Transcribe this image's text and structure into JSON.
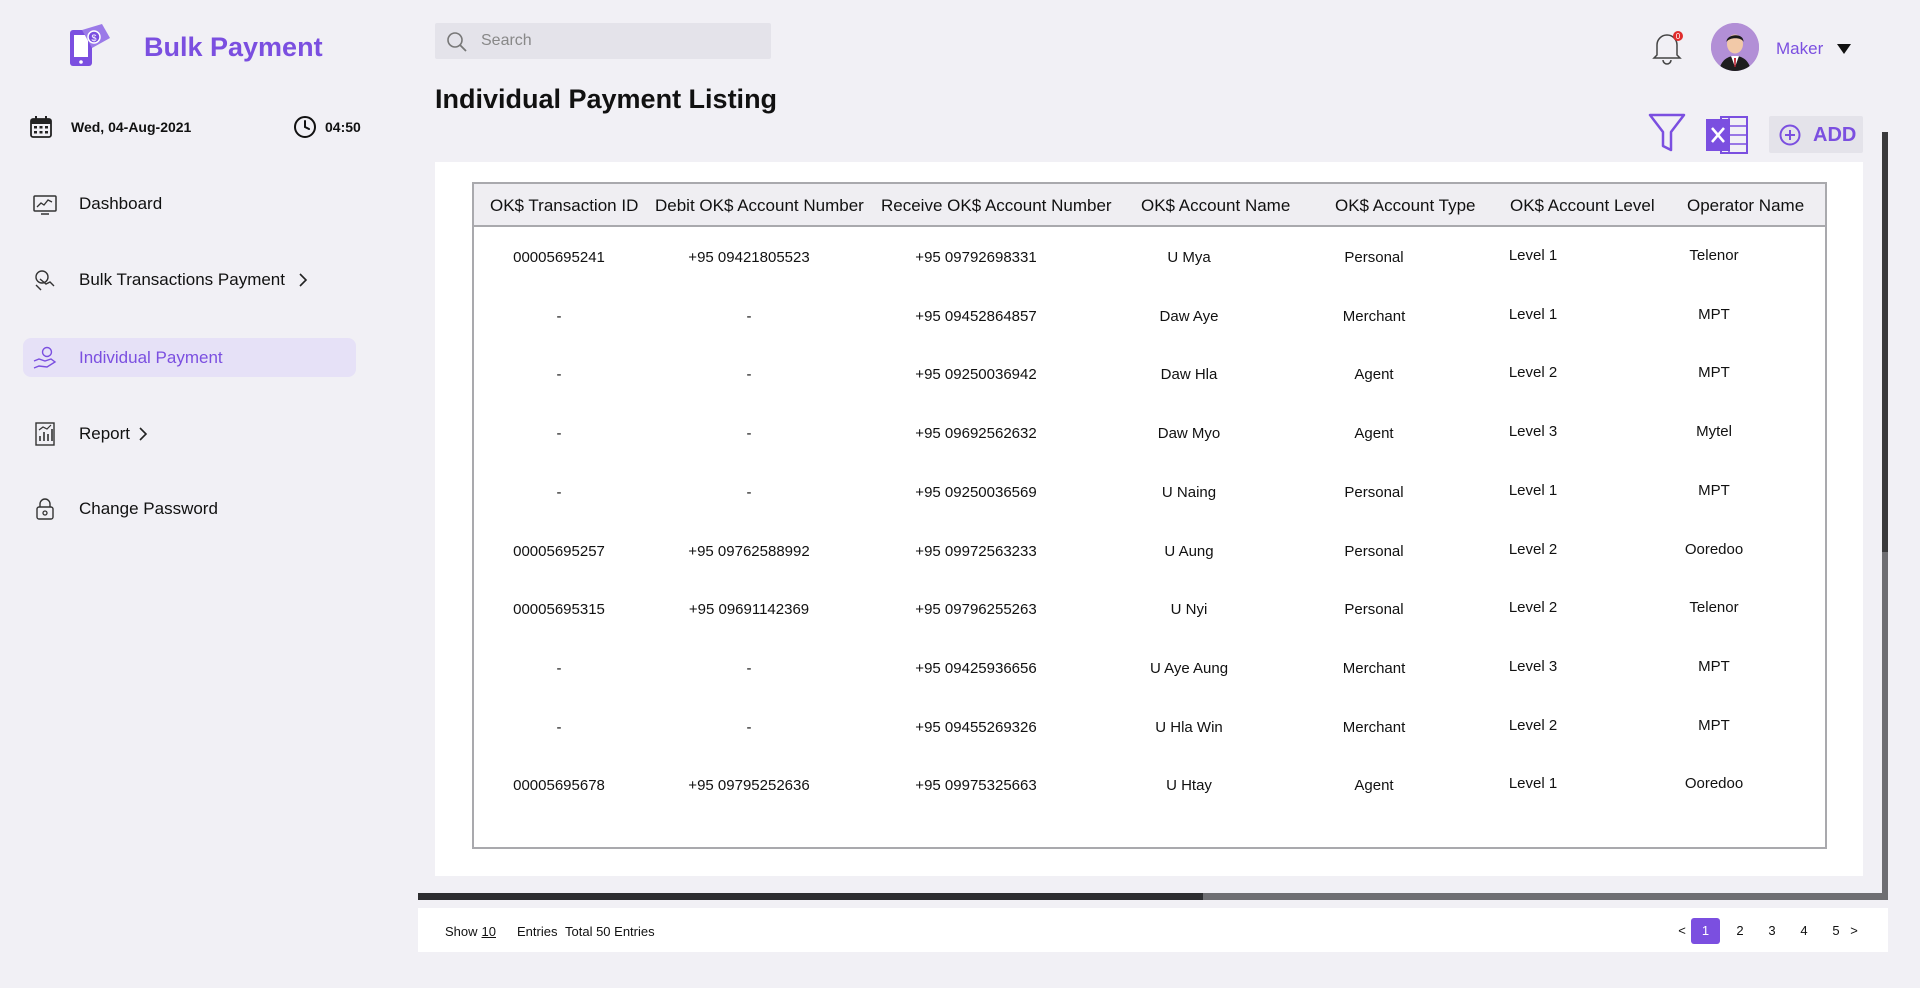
{
  "app": {
    "title": "Bulk Payment"
  },
  "date_time": {
    "date": "Wed, 04-Aug-2021",
    "time": "04:50"
  },
  "sidebar": {
    "items": [
      {
        "label": "Dashboard",
        "icon": "dashboard-icon"
      },
      {
        "label": "Bulk Transactions Payment",
        "icon": "bulk-transactions-icon",
        "has_submenu": true
      },
      {
        "label": "Individual Payment",
        "icon": "individual-payment-icon",
        "active": true
      },
      {
        "label": "Report",
        "icon": "report-icon",
        "has_submenu": true
      },
      {
        "label": "Change Password",
        "icon": "lock-icon"
      }
    ]
  },
  "search": {
    "placeholder": "Search",
    "value": ""
  },
  "header": {
    "notifications_count": "0",
    "user": "Maker"
  },
  "page": {
    "title": "Individual Payment Listing"
  },
  "toolbar": {
    "add_label": "ADD"
  },
  "table": {
    "columns": [
      "OK$ Transaction ID",
      "Debit OK$ Account Number",
      "Receive OK$ Account Number",
      "OK$ Account Name",
      "OK$ Account Type",
      "OK$ Account Level",
      "Operator Name"
    ],
    "rows": [
      [
        "00005695241",
        "+95 09421805523",
        "+95 09792698331",
        "U Mya",
        "Personal",
        "Level 1",
        "Telenor"
      ],
      [
        "-",
        "-",
        "+95 09452864857",
        "Daw Aye",
        "Merchant",
        "Level 1",
        "MPT"
      ],
      [
        "-",
        "-",
        "+95 09250036942",
        "Daw Hla",
        "Agent",
        "Level 2",
        "MPT"
      ],
      [
        "-",
        "-",
        "+95 09692562632",
        "Daw Myo",
        "Agent",
        "Level 3",
        "Mytel"
      ],
      [
        "-",
        "-",
        "+95 09250036569",
        "U Naing",
        "Personal",
        "Level 1",
        "MPT"
      ],
      [
        "00005695257",
        "+95 09762588992",
        "+95 09972563233",
        "U Aung",
        "Personal",
        "Level 2",
        "Ooredoo"
      ],
      [
        "00005695315",
        "+95 09691142369",
        "+95 09796255263",
        "U Nyi",
        "Personal",
        "Level 2",
        "Telenor"
      ],
      [
        "-",
        "-",
        "+95 09425936656",
        "U Aye Aung",
        "Merchant",
        "Level 3",
        "MPT"
      ],
      [
        "-",
        "-",
        "+95 09455269326",
        "U Hla Win",
        "Merchant",
        "Level 2",
        "MPT"
      ],
      [
        "00005695678",
        "+95 09795252636",
        "+95 09975325663",
        "U Htay",
        "Agent",
        "Level 1",
        "Ooredoo"
      ]
    ]
  },
  "footer": {
    "show_label": "Show",
    "page_size": "10",
    "entries_label": "Entries",
    "total_label": "Total 50 Entries",
    "prev": "<",
    "next": ">",
    "pages": [
      "1",
      "2",
      "3",
      "4",
      "5"
    ],
    "current_page": "1"
  },
  "colors": {
    "accent": "#7b4fe0",
    "active_bg": "#e6e1f7",
    "background": "#f1f0f5"
  }
}
